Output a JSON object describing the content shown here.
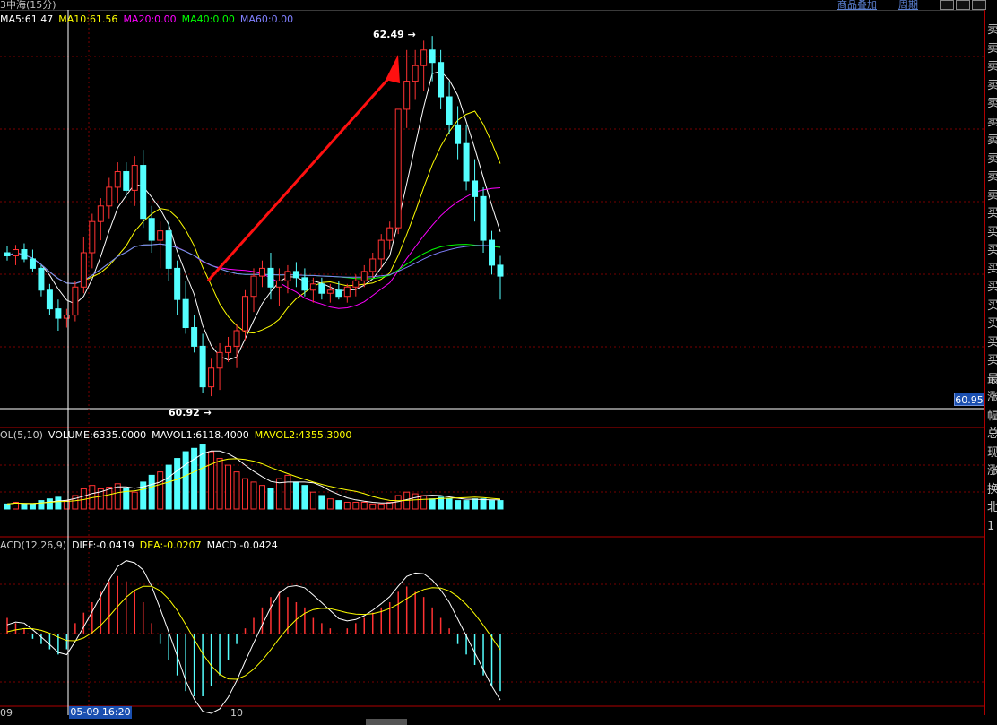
{
  "topbar": {
    "left_text": "3中海(15分)",
    "link1": "商品叠加",
    "link2": "周期"
  },
  "price_legend": {
    "ma5": "MA5:61.47",
    "ma10": "MA10:61.56",
    "ma20": "MA20:0.00",
    "ma40": "MA40:0.00",
    "ma60": "MA60:0.00"
  },
  "vol_legend": {
    "label": "OL(5,10)",
    "volume": "VOLUME:6335.0000",
    "mavol1": "MAVOL1:6118.4000",
    "mavol2": "MAVOL2:4355.3000"
  },
  "macd_legend": {
    "label": "ACD(12,26,9)",
    "diff": "DIFF:-0.0419",
    "dea": "DEA:-0.0207",
    "macd": "MACD:-0.0424"
  },
  "high_label": "62.49",
  "low_label": "60.92",
  "current_price_tag": "60.95",
  "crosshair_time": "05-09 16:20",
  "x_labels": {
    "left": "09",
    "mid": "10"
  },
  "right_panel_chars": [
    "卖",
    "卖",
    "卖",
    "卖",
    "卖",
    "卖",
    "卖",
    "卖",
    "卖",
    "卖",
    "买",
    "买",
    "买",
    "买",
    "买",
    "买",
    "买",
    "买",
    "买",
    "最",
    "涨",
    "幅",
    "总",
    "现",
    "涨",
    "换",
    "北",
    "1"
  ],
  "colors": {
    "up": "#ff3232",
    "down": "#54ffff",
    "ma5": "#ffffff",
    "ma10": "#ffff00",
    "ma20": "#ff00ff",
    "ma40": "#00ff00",
    "ma60": "#8080ff",
    "grid": "#7a0000",
    "arrow": "#ff1010"
  },
  "candles": [
    [
      61.1,
      61.14,
      61.05,
      61.08
    ],
    [
      61.08,
      61.15,
      61.02,
      61.12
    ],
    [
      61.12,
      61.16,
      61.04,
      61.06
    ],
    [
      61.06,
      61.12,
      60.98,
      61.0
    ],
    [
      61.0,
      61.02,
      60.82,
      60.86
    ],
    [
      60.86,
      60.9,
      60.7,
      60.74
    ],
    [
      60.74,
      60.8,
      60.6,
      60.68
    ],
    [
      60.68,
      60.74,
      60.62,
      60.7
    ],
    [
      60.7,
      60.92,
      60.66,
      60.88
    ],
    [
      60.88,
      61.2,
      60.84,
      61.1
    ],
    [
      61.1,
      61.35,
      61.0,
      61.3
    ],
    [
      61.3,
      61.45,
      61.18,
      61.4
    ],
    [
      61.4,
      61.58,
      61.32,
      61.52
    ],
    [
      61.52,
      61.68,
      61.42,
      61.62
    ],
    [
      61.62,
      61.68,
      61.46,
      61.5
    ],
    [
      61.5,
      61.72,
      61.4,
      61.66
    ],
    [
      61.66,
      61.76,
      61.26,
      61.32
    ],
    [
      61.32,
      61.4,
      61.1,
      61.18
    ],
    [
      61.18,
      61.3,
      61.0,
      61.24
    ],
    [
      61.24,
      61.3,
      60.92,
      61.0
    ],
    [
      61.0,
      61.05,
      60.7,
      60.8
    ],
    [
      60.8,
      60.92,
      60.58,
      60.62
    ],
    [
      60.62,
      60.7,
      60.46,
      60.5
    ],
    [
      60.5,
      60.58,
      60.2,
      60.24
    ],
    [
      60.24,
      60.42,
      60.18,
      60.36
    ],
    [
      60.36,
      60.52,
      60.22,
      60.46
    ],
    [
      60.46,
      60.56,
      60.4,
      60.5
    ],
    [
      60.5,
      60.64,
      60.36,
      60.6
    ],
    [
      60.6,
      60.86,
      60.54,
      60.82
    ],
    [
      60.82,
      61.0,
      60.72,
      60.95
    ],
    [
      60.95,
      61.05,
      60.88,
      61.0
    ],
    [
      61.0,
      61.1,
      60.8,
      60.88
    ],
    [
      60.88,
      61.0,
      60.76,
      60.92
    ],
    [
      60.92,
      61.02,
      60.84,
      60.98
    ],
    [
      60.98,
      61.04,
      60.88,
      60.94
    ],
    [
      60.94,
      61.0,
      60.82,
      60.86
    ],
    [
      60.86,
      60.94,
      60.78,
      60.9
    ],
    [
      60.9,
      60.94,
      60.8,
      60.84
    ],
    [
      60.84,
      60.9,
      60.78,
      60.86
    ],
    [
      60.86,
      60.92,
      60.8,
      60.82
    ],
    [
      60.82,
      60.9,
      60.78,
      60.88
    ],
    [
      60.88,
      60.96,
      60.82,
      60.92
    ],
    [
      60.92,
      61.02,
      60.88,
      60.98
    ],
    [
      60.98,
      61.1,
      60.94,
      61.06
    ],
    [
      61.06,
      61.22,
      61.0,
      61.18
    ],
    [
      61.18,
      61.3,
      61.12,
      61.26
    ],
    [
      61.26,
      61.74,
      61.22,
      62.02
    ],
    [
      62.02,
      62.4,
      61.9,
      62.2
    ],
    [
      62.2,
      62.4,
      62.08,
      62.3
    ],
    [
      62.3,
      62.46,
      62.14,
      62.4
    ],
    [
      62.4,
      62.49,
      62.2,
      62.32
    ],
    [
      62.32,
      62.4,
      62.02,
      62.1
    ],
    [
      62.1,
      62.2,
      61.86,
      61.92
    ],
    [
      61.92,
      62.04,
      61.7,
      61.8
    ],
    [
      61.8,
      61.92,
      61.5,
      61.56
    ],
    [
      61.56,
      61.7,
      61.3,
      61.46
    ],
    [
      61.46,
      61.52,
      61.1,
      61.18
    ],
    [
      61.18,
      61.24,
      60.96,
      61.02
    ],
    [
      61.02,
      61.08,
      60.8,
      60.95
    ]
  ],
  "volumes": [
    3,
    4,
    3,
    3,
    5,
    6,
    7,
    5,
    8,
    12,
    14,
    12,
    13,
    15,
    12,
    10,
    16,
    20,
    22,
    26,
    30,
    34,
    36,
    38,
    34,
    30,
    26,
    22,
    18,
    16,
    14,
    12,
    18,
    20,
    16,
    14,
    10,
    8,
    6,
    5,
    4,
    4,
    4,
    3,
    3,
    4,
    8,
    10,
    9,
    8,
    6,
    7,
    6,
    5,
    5,
    6,
    6,
    5,
    5
  ],
  "macd_hist": [
    0.03,
    0.02,
    0.01,
    -0.01,
    -0.02,
    -0.03,
    -0.04,
    -0.03,
    0.02,
    0.04,
    0.06,
    0.08,
    0.1,
    0.11,
    0.1,
    0.08,
    0.06,
    0.02,
    -0.02,
    -0.05,
    -0.08,
    -0.11,
    -0.12,
    -0.12,
    -0.1,
    -0.08,
    -0.05,
    -0.02,
    0.01,
    0.03,
    0.05,
    0.07,
    0.08,
    0.07,
    0.06,
    0.05,
    0.03,
    0.02,
    0.01,
    0.0,
    0.01,
    0.02,
    0.03,
    0.04,
    0.05,
    0.06,
    0.08,
    0.09,
    0.08,
    0.07,
    0.05,
    0.03,
    0.01,
    -0.02,
    -0.04,
    -0.06,
    -0.08,
    -0.1,
    -0.11
  ]
}
